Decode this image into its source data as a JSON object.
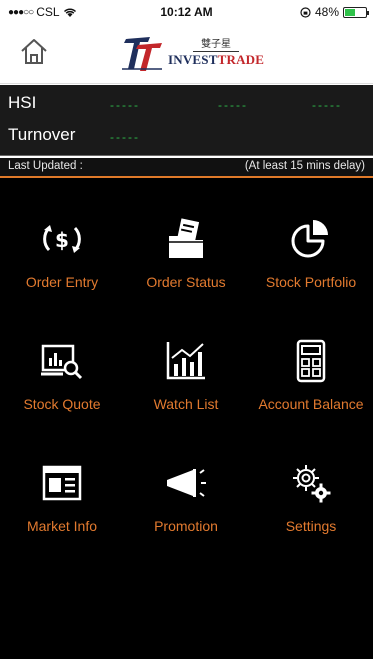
{
  "status_bar": {
    "carrier": "CSL",
    "time": "10:12 AM",
    "battery": "48%",
    "battery_level": 0.48
  },
  "header": {
    "logo_cn": "雙子星",
    "logo_en_1": "INVEST",
    "logo_en_2": "TRADE"
  },
  "ticker": {
    "hsi_label": "HSI",
    "hsi_values": [
      "-----",
      "-----",
      "-----"
    ],
    "turnover_label": "Turnover",
    "turnover_value": "-----"
  },
  "update_bar": {
    "label": "Last Updated :",
    "note": "(At least 15 mins delay)"
  },
  "menu": {
    "items": [
      {
        "label": "Order Entry",
        "icon": "currency-exchange-icon"
      },
      {
        "label": "Order Status",
        "icon": "folder-documents-icon"
      },
      {
        "label": "Stock Portfolio",
        "icon": "pie-chart-icon"
      },
      {
        "label": "Stock Quote",
        "icon": "chart-magnifier-icon"
      },
      {
        "label": "Watch List",
        "icon": "bar-line-chart-icon"
      },
      {
        "label": "Account Balance",
        "icon": "calculator-icon"
      },
      {
        "label": "Market Info",
        "icon": "newspaper-icon"
      },
      {
        "label": "Promotion",
        "icon": "megaphone-icon"
      },
      {
        "label": "Settings",
        "icon": "gears-icon"
      }
    ]
  },
  "colors": {
    "accent": "#e27a2f",
    "ticker_green": "#2fb84a",
    "background": "#000000"
  }
}
